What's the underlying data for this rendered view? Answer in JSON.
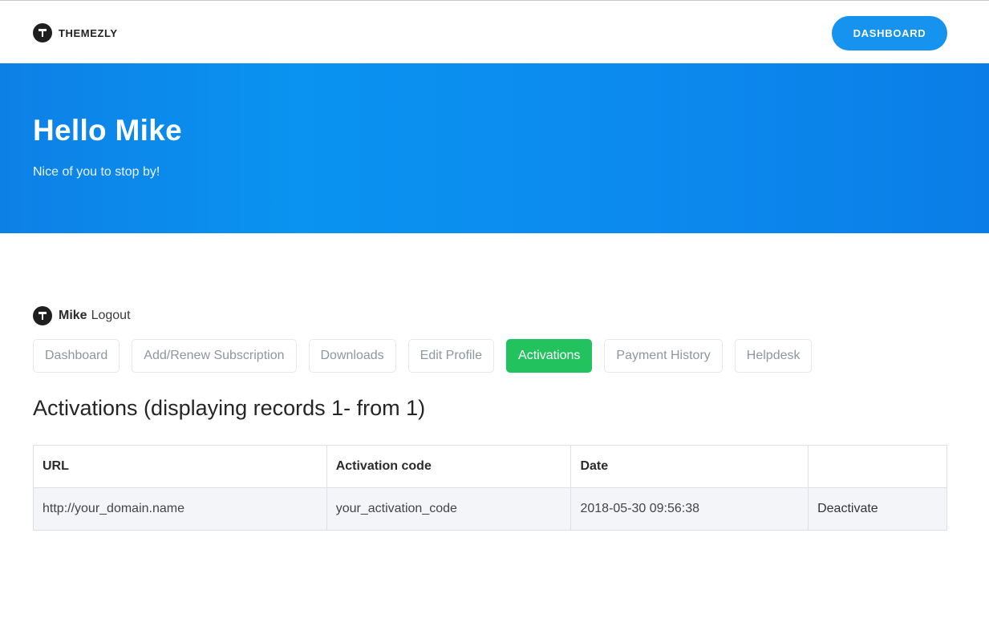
{
  "header": {
    "brand": "THEMEZLY",
    "dashboard_button": "DASHBOARD"
  },
  "hero": {
    "title": "Hello Mike",
    "subtitle": "Nice of you to stop by!"
  },
  "user": {
    "name": "Mike",
    "logout": "Logout"
  },
  "tabs": [
    {
      "label": "Dashboard",
      "active": false
    },
    {
      "label": "Add/Renew Subscription",
      "active": false
    },
    {
      "label": "Downloads",
      "active": false
    },
    {
      "label": "Edit Profile",
      "active": false
    },
    {
      "label": "Activations",
      "active": true
    },
    {
      "label": "Payment History",
      "active": false
    },
    {
      "label": "Helpdesk",
      "active": false
    }
  ],
  "section_title": "Activations (displaying records 1- from 1)",
  "table": {
    "columns": [
      "URL",
      "Activation code",
      "Date",
      ""
    ],
    "rows": [
      {
        "url": "http://your_domain.name",
        "code": "your_activation_code",
        "date": "2018-05-30 09:56:38",
        "action": "Deactivate"
      }
    ]
  },
  "colors": {
    "accent_blue": "#1593ee",
    "active_tab_green": "#22c35e",
    "hero_gradient_start": "#0d80e6",
    "hero_gradient_end": "#0a7ee6"
  },
  "icons": {
    "brand_logo": "themezly-logo-icon",
    "user_avatar": "avatar-icon"
  }
}
